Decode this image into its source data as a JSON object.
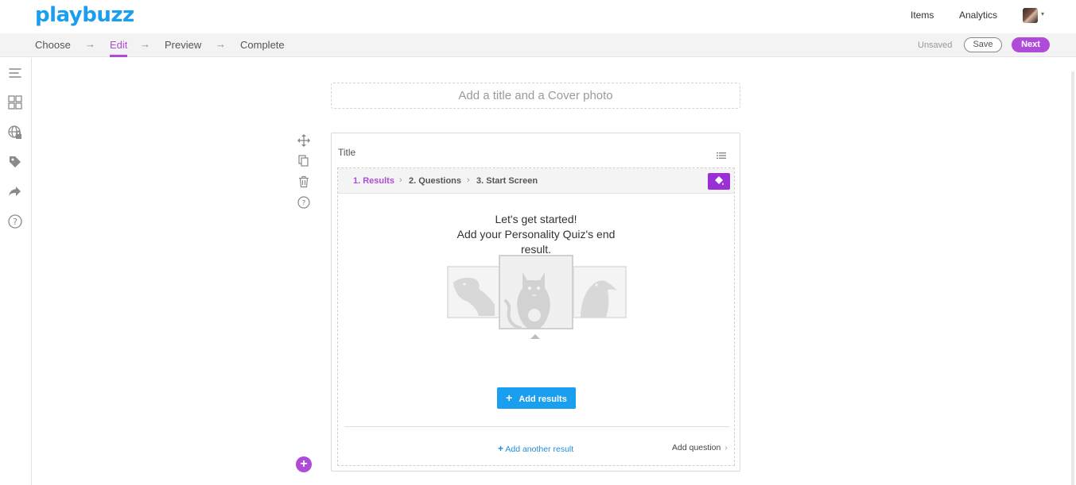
{
  "header": {
    "logo": "playbuzz",
    "items_link": "Items",
    "analytics_link": "Analytics",
    "avatar_caret": "▾"
  },
  "steps": {
    "choose": "Choose",
    "edit": "Edit",
    "preview": "Preview",
    "complete": "Complete",
    "arrow": "→",
    "active": "Edit"
  },
  "status": {
    "unsaved": "Unsaved",
    "save_label": "Save",
    "next_label": "Next"
  },
  "sidebar": {
    "icons": [
      "menu-lines-icon",
      "grid-icon",
      "globe-lock-icon",
      "tag-icon",
      "share-arrow-icon",
      "help-icon"
    ]
  },
  "editor": {
    "cover_placeholder": "Add a title and a Cover photo",
    "tools": [
      "move-icon",
      "copy-icon",
      "trash-icon",
      "help-icon"
    ],
    "card_title": "Title",
    "breadcrumb": {
      "results": "1. Results",
      "questions": "2. Questions",
      "start": "3. Start Screen",
      "sep": "›"
    },
    "heading_line1": "Let's get started!",
    "heading_line2": "Add your Personality Quiz's end",
    "heading_line3": "result.",
    "add_results_plus": "+",
    "add_results_label": "Add results",
    "add_another_plus": "+",
    "add_another_label": "Add another result",
    "add_question_label": "Add question",
    "add_question_chevron": "›",
    "add_block_plus": "+"
  },
  "colors": {
    "brand_blue": "#1a9ff0",
    "accent_purple": "#b04bd9",
    "paint_purple": "#9b2fd6"
  }
}
